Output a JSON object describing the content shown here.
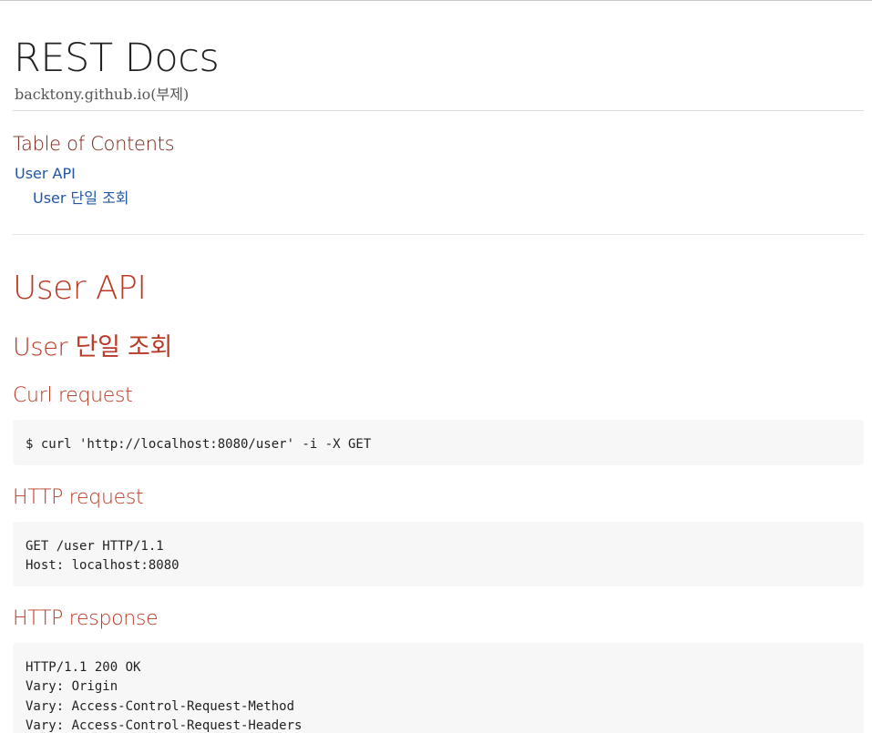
{
  "header": {
    "title": "REST Docs",
    "subtitle": "backtony.github.io(부제)"
  },
  "toc": {
    "title": "Table of Contents",
    "items": [
      {
        "label": "User API",
        "level": 1
      },
      {
        "label": "User 단일 조회",
        "level": 2
      }
    ]
  },
  "content": {
    "section1_title": "User API",
    "section2_title": "User 단일 조회",
    "blocks": [
      {
        "heading": "Curl request",
        "code": "$ curl 'http://localhost:8080/user' -i -X GET"
      },
      {
        "heading": "HTTP request",
        "code": "GET /user HTTP/1.1\nHost: localhost:8080"
      },
      {
        "heading": "HTTP response",
        "code": "HTTP/1.1 200 OK\nVary: Origin\nVary: Access-Control-Request-Method\nVary: Access-Control-Request-Headers"
      }
    ]
  },
  "colors": {
    "heading": "#ba3925",
    "toc_title": "#7a2518",
    "link": "#2156a5",
    "listing_bg": "#f7f7f8"
  }
}
